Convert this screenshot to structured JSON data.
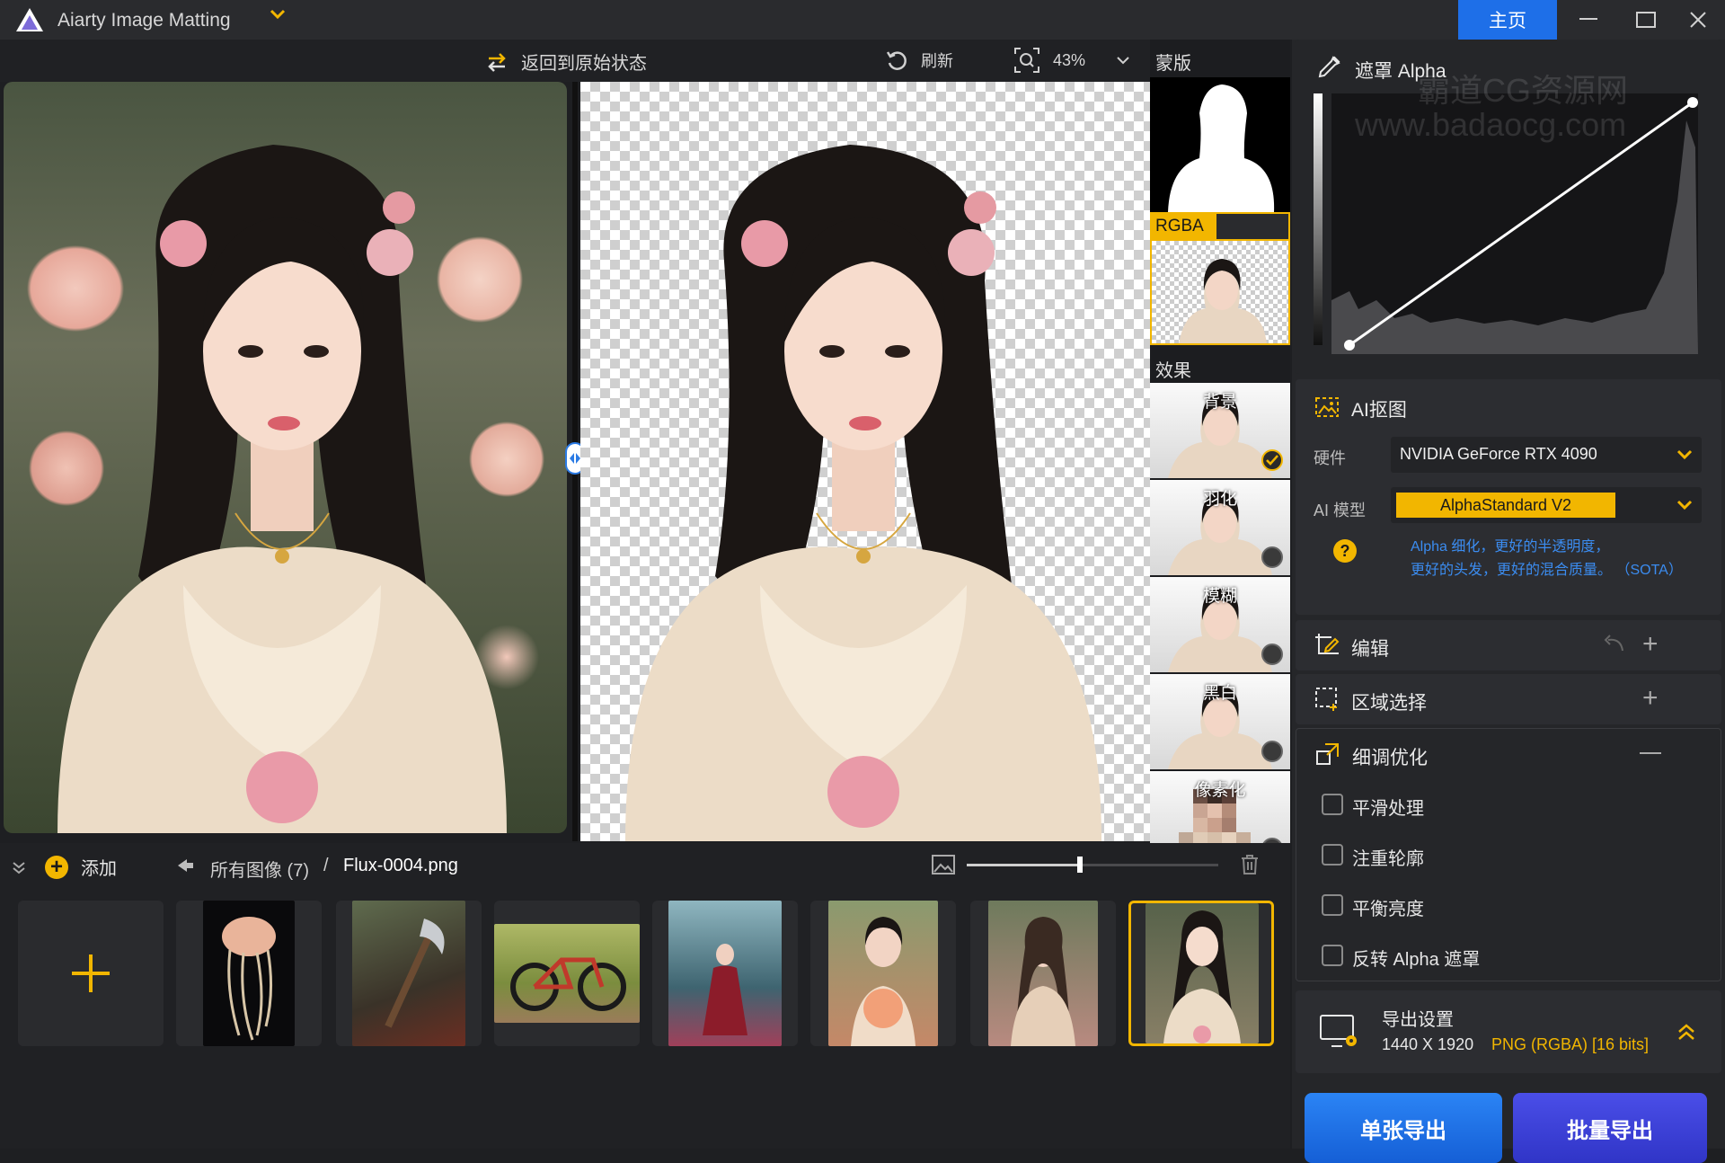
{
  "app": {
    "title": "Aiarty Image Matting",
    "home_label": "主页",
    "window_controls": [
      "minimize-icon",
      "maximize-icon",
      "close-icon"
    ]
  },
  "preview_toolbar": {
    "reset_label": "返回到原始状态",
    "refresh_label": "刷新",
    "zoom_value": "43%"
  },
  "mask_strip": {
    "mask_label": "蒙版",
    "rgba_label": "RGBA",
    "effects_label": "效果",
    "effects": [
      {
        "label": "背景",
        "selected": true
      },
      {
        "label": "羽化",
        "selected": false
      },
      {
        "label": "模糊",
        "selected": false
      },
      {
        "label": "黑白",
        "selected": false
      },
      {
        "label": "像素化",
        "selected": false
      }
    ]
  },
  "alpha_section": {
    "title": "遮罩 Alpha"
  },
  "ai_matting": {
    "title": "AI抠图",
    "hardware_label": "硬件",
    "hardware_value": "NVIDIA GeForce RTX 4090",
    "model_label": "AI 模型",
    "model_value": "AlphaStandard  V2",
    "model_desc_line1": "Alpha 细化，更好的半透明度，",
    "model_desc_line2": "更好的头发，更好的混合质量。 （SOTA）"
  },
  "edit_section": {
    "title": "编辑"
  },
  "region_section": {
    "title": "区域选择"
  },
  "refine_section": {
    "title": "细调优化",
    "options": [
      {
        "label": "平滑处理",
        "checked": false
      },
      {
        "label": "注重轮廓",
        "checked": false
      },
      {
        "label": "平衡亮度",
        "checked": false
      },
      {
        "label": "反转 Alpha 遮罩",
        "checked": false
      }
    ]
  },
  "export_settings": {
    "title": "导出设置",
    "dimensions": "1440 X 1920",
    "format": "PNG (RGBA) [16 bits]"
  },
  "export_buttons": {
    "single": "单张导出",
    "batch": "批量导出"
  },
  "bottom_bar": {
    "add_label": "添加",
    "all_images_label": "所有图像 (7)",
    "separator": "/",
    "current_file": "Flux-0004.png",
    "thumbnail_size_fraction": 0.45
  },
  "thumbnails": [
    {
      "name": "jellyfish",
      "selected": false
    },
    {
      "name": "forest-axe",
      "selected": false
    },
    {
      "name": "bicycle",
      "selected": false
    },
    {
      "name": "red-dress-forest",
      "selected": false
    },
    {
      "name": "girl-peony",
      "selected": false
    },
    {
      "name": "girl-flowers",
      "selected": false
    },
    {
      "name": "flux-0004",
      "selected": true
    }
  ],
  "watermark": {
    "line1": "霸道CG资源网",
    "line2": "www.badaocg.com"
  },
  "colors": {
    "accent_yellow": "#f2b600",
    "primary_blue": "#1e6fe8",
    "batch_blue": "#3b3fd6",
    "link_blue": "#3b8cf0"
  }
}
